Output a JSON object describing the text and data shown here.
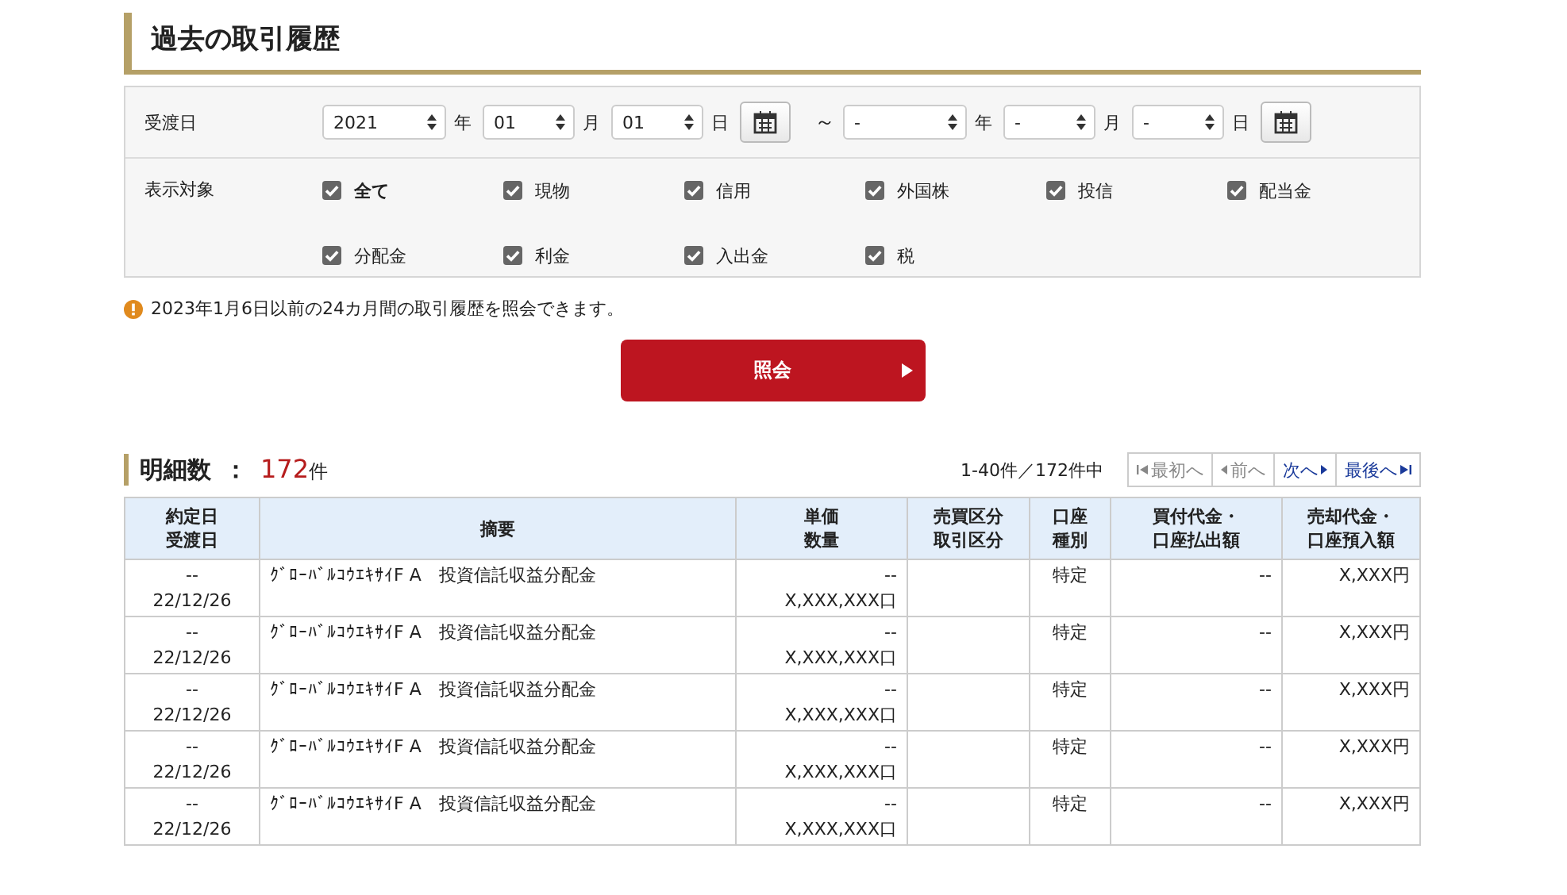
{
  "page_title": "過去の取引履歴",
  "filter": {
    "date_label": "受渡日",
    "from": [
      {
        "value": "2021",
        "unit": "年"
      },
      {
        "value": "01",
        "unit": "月"
      },
      {
        "value": "01",
        "unit": "日"
      }
    ],
    "tilde": "～",
    "to": [
      {
        "value": "-",
        "unit": "年"
      },
      {
        "value": "-",
        "unit": "月"
      },
      {
        "value": "-",
        "unit": "日"
      }
    ],
    "target_label": "表示対象",
    "targets": [
      {
        "label": "全て",
        "checked": true,
        "bold": true
      },
      {
        "label": "現物",
        "checked": true,
        "bold": false
      },
      {
        "label": "信用",
        "checked": true,
        "bold": false
      },
      {
        "label": "外国株",
        "checked": true,
        "bold": false
      },
      {
        "label": "投信",
        "checked": true,
        "bold": false
      },
      {
        "label": "配当金",
        "checked": true,
        "bold": false
      },
      {
        "label": "分配金",
        "checked": true,
        "bold": false
      },
      {
        "label": "利金",
        "checked": true,
        "bold": false
      },
      {
        "label": "入出金",
        "checked": true,
        "bold": false
      },
      {
        "label": "税",
        "checked": true,
        "bold": false
      }
    ]
  },
  "notice": "2023年1月6日以前の24カ月間の取引履歴を照会できます。",
  "search_button": "照会",
  "results": {
    "label": "明細数",
    "colon": "：",
    "count": "172",
    "count_unit": "件",
    "range": "1-40件／172件中",
    "pager": [
      {
        "label": "最初へ",
        "kind": "first",
        "disabled": true
      },
      {
        "label": "前へ",
        "kind": "prev",
        "disabled": true
      },
      {
        "label": "次へ",
        "kind": "next",
        "disabled": false
      },
      {
        "label": "最後へ",
        "kind": "last",
        "disabled": false
      }
    ]
  },
  "table": {
    "columns": [
      [
        "約定日",
        "受渡日"
      ],
      [
        "摘要"
      ],
      [
        "単価",
        "数量"
      ],
      [
        "売買区分",
        "取引区分"
      ],
      [
        "口座",
        "種別"
      ],
      [
        "買付代金・",
        "口座払出額"
      ],
      [
        "売却代金・",
        "口座預入額"
      ]
    ],
    "rows": [
      {
        "trade_date": "--",
        "delivery_date": "22/12/26",
        "summary": "ｸﾞﾛｰﾊﾞﾙｺｳｴｷｻｲF A　投資信託収益分配金",
        "price": "--",
        "quantity": "X,XXX,XXX口",
        "account": "特定",
        "buy": "--",
        "sell": "X,XXX円"
      },
      {
        "trade_date": "--",
        "delivery_date": "22/12/26",
        "summary": "ｸﾞﾛｰﾊﾞﾙｺｳｴｷｻｲF A　投資信託収益分配金",
        "price": "--",
        "quantity": "X,XXX,XXX口",
        "account": "特定",
        "buy": "--",
        "sell": "X,XXX円"
      },
      {
        "trade_date": "--",
        "delivery_date": "22/12/26",
        "summary": "ｸﾞﾛｰﾊﾞﾙｺｳｴｷｻｲF A　投資信託収益分配金",
        "price": "--",
        "quantity": "X,XXX,XXX口",
        "account": "特定",
        "buy": "--",
        "sell": "X,XXX円"
      },
      {
        "trade_date": "--",
        "delivery_date": "22/12/26",
        "summary": "ｸﾞﾛｰﾊﾞﾙｺｳｴｷｻｲF A　投資信託収益分配金",
        "price": "--",
        "quantity": "X,XXX,XXX口",
        "account": "特定",
        "buy": "--",
        "sell": "X,XXX円"
      },
      {
        "trade_date": "--",
        "delivery_date": "22/12/26",
        "summary": "ｸﾞﾛｰﾊﾞﾙｺｳｴｷｻｲF A　投資信託収益分配金",
        "price": "--",
        "quantity": "X,XXX,XXX口",
        "account": "特定",
        "buy": "--",
        "sell": "X,XXX円"
      }
    ]
  }
}
